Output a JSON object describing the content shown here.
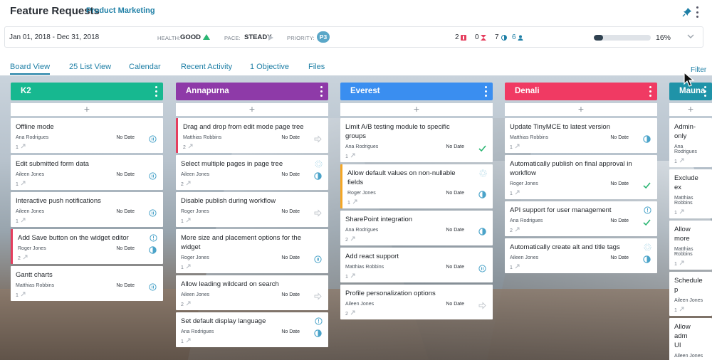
{
  "header": {
    "title": "Feature Requests",
    "subtitle": "Product Marketing"
  },
  "summary": {
    "date_range": "Jan 01, 2018   -   Dec 31, 2018",
    "health_label": "HEALTH:",
    "health_value": "GOOD",
    "pace_label": "PACE:",
    "pace_value": "STEADY",
    "priority_label": "PRIORITY:",
    "priority_value": "P3",
    "count_overdue": "2",
    "count_hourglass": "0",
    "count_progress": "7",
    "count_users": "6",
    "progress_fraction": 0.16,
    "progress_label": "16%"
  },
  "tabs": [
    "Board View",
    "25 List View",
    "Calendar",
    "Recent Activity",
    "1 Objective",
    "Files"
  ],
  "filter_label": "Filter",
  "add_symbol": "+",
  "columns": [
    {
      "name": "K2",
      "color": "#17b890",
      "cards": [
        {
          "title": "Offline mode",
          "owner": "Ana Rodrigues",
          "due": "No Date",
          "count": "1",
          "status": "pause",
          "flag": "",
          "top": ""
        },
        {
          "title": "Edit submitted form data",
          "owner": "Aileen Jones",
          "due": "No Date",
          "count": "1",
          "status": "pause",
          "flag": "",
          "top": ""
        },
        {
          "title": "Interactive push notifications",
          "owner": "Aileen Jones",
          "due": "No Date",
          "count": "1",
          "status": "pause",
          "flag": "",
          "top": ""
        },
        {
          "title": "Add Save button on the widget editor",
          "owner": "Roger Jones",
          "due": "No Date",
          "count": "2",
          "status": "half",
          "flag": "red",
          "top": "info"
        },
        {
          "title": "Gantt charts",
          "owner": "Matthias Robbins",
          "due": "No Date",
          "count": "1",
          "status": "pause",
          "flag": "",
          "top": ""
        }
      ]
    },
    {
      "name": "Annapurna",
      "color": "#8e3aa8",
      "cards": [
        {
          "title": "Drag and drop from edit mode page tree",
          "owner": "Matthias Robbins",
          "due": "No Date",
          "count": "2",
          "status": "arrow",
          "flag": "red",
          "top": ""
        },
        {
          "title": "Select multiple pages in page tree",
          "owner": "Aileen Jones",
          "due": "No Date",
          "count": "2",
          "status": "half",
          "flag": "",
          "top": "dots"
        },
        {
          "title": "Disable publish during workflow",
          "owner": "Roger Jones",
          "due": "No Date",
          "count": "1",
          "status": "arrow",
          "flag": "",
          "top": ""
        },
        {
          "title": "More size and placement options for the widget",
          "owner": "Roger Jones",
          "due": "No Date",
          "count": "1",
          "status": "pause",
          "flag": "",
          "top": ""
        },
        {
          "title": "Allow leading wildcard on search",
          "owner": "Aileen Jones",
          "due": "No Date",
          "count": "2",
          "status": "arrow",
          "flag": "",
          "top": ""
        },
        {
          "title": "Set default display language",
          "owner": "Ana Rodrigues",
          "due": "No Date",
          "count": "1",
          "status": "half",
          "flag": "",
          "top": "info"
        }
      ]
    },
    {
      "name": "Everest",
      "color": "#3a8ef0",
      "cards": [
        {
          "title": "Limit A/B testing module to specific groups",
          "owner": "Ana Rodrigues",
          "due": "No Date",
          "count": "1",
          "status": "check",
          "flag": "",
          "top": ""
        },
        {
          "title": "Allow default values on non-nullable fields",
          "owner": "Roger Jones",
          "due": "No Date",
          "count": "1",
          "status": "half",
          "flag": "orange",
          "top": "dots"
        },
        {
          "title": "SharePoint integration",
          "owner": "Ana Rodrigues",
          "due": "No Date",
          "count": "2",
          "status": "half",
          "flag": "",
          "top": ""
        },
        {
          "title": "Add react support",
          "owner": "Matthias Robbins",
          "due": "No Date",
          "count": "1",
          "status": "pause",
          "flag": "",
          "top": ""
        },
        {
          "title": "Profile personalization options",
          "owner": "Aileen Jones",
          "due": "No Date",
          "count": "2",
          "status": "arrow",
          "flag": "",
          "top": ""
        }
      ]
    },
    {
      "name": "Denali",
      "color": "#f03a63",
      "cards": [
        {
          "title": "Update TinyMCE to latest version",
          "owner": "Matthias Robbins",
          "due": "No Date",
          "count": "1",
          "status": "half",
          "flag": "",
          "top": ""
        },
        {
          "title": "Automatically publish on final approval in workflow",
          "owner": "Roger Jones",
          "due": "No Date",
          "count": "1",
          "status": "check",
          "flag": "",
          "top": ""
        },
        {
          "title": "API support for user management",
          "owner": "Ana Rodrigues",
          "due": "No Date",
          "count": "2",
          "status": "check",
          "flag": "",
          "top": "info"
        },
        {
          "title": "Automatically create alt and title tags",
          "owner": "Aileen Jones",
          "due": "No Date",
          "count": "1",
          "status": "half",
          "flag": "",
          "top": "dots"
        }
      ]
    },
    {
      "name": "Mauna",
      "color": "#1f93a8",
      "cards": [
        {
          "title": "Admin-only",
          "owner": "Ana Rodrigues",
          "due": "",
          "count": "1",
          "status": "",
          "flag": "",
          "top": ""
        },
        {
          "title": "Exclude ex",
          "owner": "Matthias Robbins",
          "due": "",
          "count": "1",
          "status": "",
          "flag": "",
          "top": ""
        },
        {
          "title": "Allow more",
          "owner": "Matthias Robbins",
          "due": "",
          "count": "1",
          "status": "",
          "flag": "",
          "top": ""
        },
        {
          "title": "Schedule p",
          "owner": "Aileen Jones",
          "due": "",
          "count": "1",
          "status": "",
          "flag": "",
          "top": ""
        },
        {
          "title": "Allow adm UI",
          "owner": "Aileen Jones",
          "due": "",
          "count": "1",
          "status": "",
          "flag": "",
          "top": ""
        }
      ]
    }
  ]
}
